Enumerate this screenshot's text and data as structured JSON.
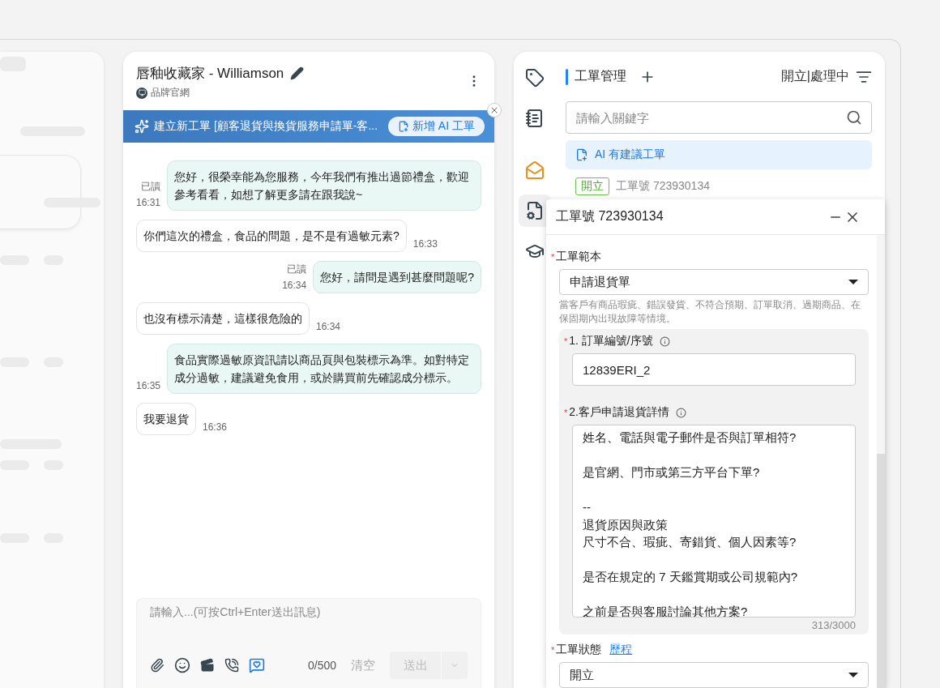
{
  "chat": {
    "title": "唇釉收藏家 - Williamson",
    "channel": "品牌官網",
    "banner": {
      "text": "建立新工單 [顧客退貨與換貨服務申請單-客...",
      "button": "新增 AI 工單"
    },
    "messages": [
      {
        "kind": "agent",
        "text": "您好，很榮幸能為您服務，今年我們有推出過節禮盒，歡迎參考看看，如想了解更多請在跟我說~",
        "time": "16:31",
        "read_label": "已讀"
      },
      {
        "kind": "customer",
        "text": "你們這次的禮盒，食品的問題，是不是有過敏元素?",
        "time": "16:33"
      },
      {
        "kind": "agent",
        "text": "您好，請問是遇到甚麼問題呢?",
        "time": "16:34",
        "read_label": "已讀"
      },
      {
        "kind": "customer",
        "text": "也沒有標示清楚，這樣很危險的",
        "time": "16:34"
      },
      {
        "kind": "agent",
        "text": "食品實際過敏原資訊請以商品頁與包裝標示為準。如對特定成分過敏，建議避免食用，或於購買前先確認成分標示。",
        "time": "16:35"
      },
      {
        "kind": "customer",
        "text": "我要退貨",
        "time": "16:36"
      }
    ],
    "composer": {
      "placeholder": "請輸入...(可按Ctrl+Enter送出訊息)",
      "count": "0/500",
      "clear": "清空",
      "send": "送出",
      "send_disabled": true
    }
  },
  "tickets": {
    "rail": [
      {
        "selected": false
      },
      {
        "selected": false
      },
      {
        "selected": false
      },
      {
        "selected": true
      },
      {
        "selected": false
      }
    ],
    "title": "工單管理",
    "filter": "開立|處理中",
    "search_placeholder": "請輸入關鍵字",
    "ai_suggest": "AI 有建議工單",
    "list": [
      {
        "status": "開立",
        "number": "工單號 723930134"
      }
    ],
    "modal": {
      "title": "工單號 723930134",
      "required_mark": "*",
      "template_label": "工單範本",
      "template_value": "申請退貨單",
      "template_help": "當客戶有商品瑕疵、錯誤發貨、不符合預期、訂單取消、過期商品、在保固期內出現故障等情境。",
      "fields": [
        {
          "kind": "input",
          "label": "1. 訂單編號/序號",
          "value": "12839ERI_2"
        },
        {
          "kind": "textarea",
          "label": "2.客戶申請退貨詳情",
          "paragraphs": [
            [
              "姓名、電話與電子郵件是否與訂單相符?"
            ],
            [
              "是官網、門市或第三方平台下單?"
            ],
            [
              "--",
              "退貨原因與政策",
              "尺寸不合、瑕疵、寄錯貨、個人因素等?"
            ],
            [
              "是否在規定的 7 天鑑賞期或公司規範內?"
            ],
            [
              "之前是否與客服討論其他方案?"
            ]
          ],
          "count": "313/3000"
        }
      ],
      "status_label": "工單狀態",
      "history_link": "歷程",
      "status_value": "開立"
    }
  }
}
